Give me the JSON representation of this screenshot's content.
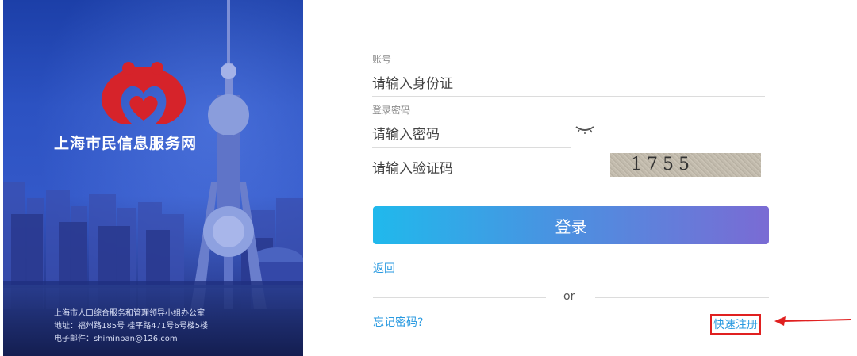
{
  "banner": {
    "brand_name": "上海市民信息服务网",
    "footer_line1": "上海市人口综合服务和管理领导小组办公室",
    "footer_line2": "地址：福州路185号    桂平路471号6号楼5楼",
    "footer_line3": "电子邮件：shiminban@126.com",
    "logo": "heart-house-logo"
  },
  "form": {
    "account_label": "账号",
    "account_placeholder": "请输入身份证",
    "password_label": "登录密码",
    "password_placeholder": "请输入密码",
    "captcha_placeholder": "请输入验证码",
    "captcha_text": "1755",
    "login_button": "登录",
    "back_link": "返回",
    "or_text": "or",
    "forgot_link": "忘记密码?",
    "register_link": "快速注册"
  },
  "colors": {
    "accent": "#2a9ae0",
    "highlight": "#e02020",
    "button_start": "#20b9ec",
    "button_end": "#7a6bd4"
  }
}
